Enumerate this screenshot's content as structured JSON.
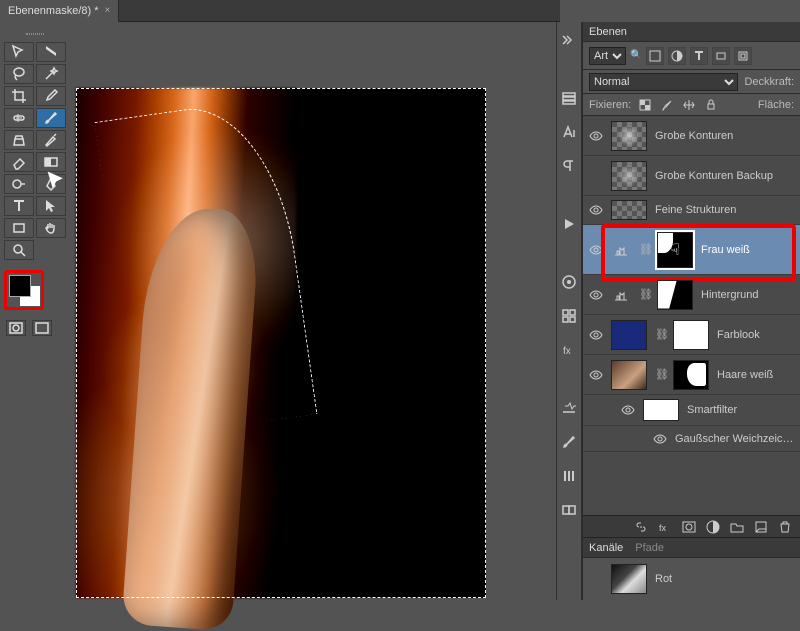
{
  "document": {
    "tab_title": "Ebenenmaske/8) *"
  },
  "panels": {
    "layers_title": "Ebenen",
    "channels_title": "Kanäle",
    "paths_title": "Pfade",
    "filter_kind": "Art",
    "blend_mode": "Normal",
    "opacity_label": "Deckkraft:",
    "lock_label": "Fixieren:",
    "fill_label": "Fläche:"
  },
  "layers": [
    {
      "name": "Grobe Konturen",
      "visible": true,
      "mask": false
    },
    {
      "name": "Grobe Konturen Backup",
      "visible": false,
      "mask": false
    },
    {
      "name": "Feine Strukturen",
      "visible": true,
      "mask": false
    },
    {
      "name": "Frau weiß",
      "visible": true,
      "mask": true,
      "selected": true,
      "smart": true
    },
    {
      "name": "Hintergrund",
      "visible": true,
      "mask": true,
      "smart": true
    },
    {
      "name": "Farblook",
      "visible": true,
      "mask": true
    },
    {
      "name": "Haare weiß",
      "visible": true,
      "mask": true
    },
    {
      "name": "Smartfilter",
      "visible": true,
      "indent": true
    },
    {
      "name": "Gaußscher Weichzeichner",
      "visible": true,
      "indent": true
    }
  ],
  "channels": [
    {
      "name": "Rot"
    }
  ],
  "search_icon_label": "🔍"
}
